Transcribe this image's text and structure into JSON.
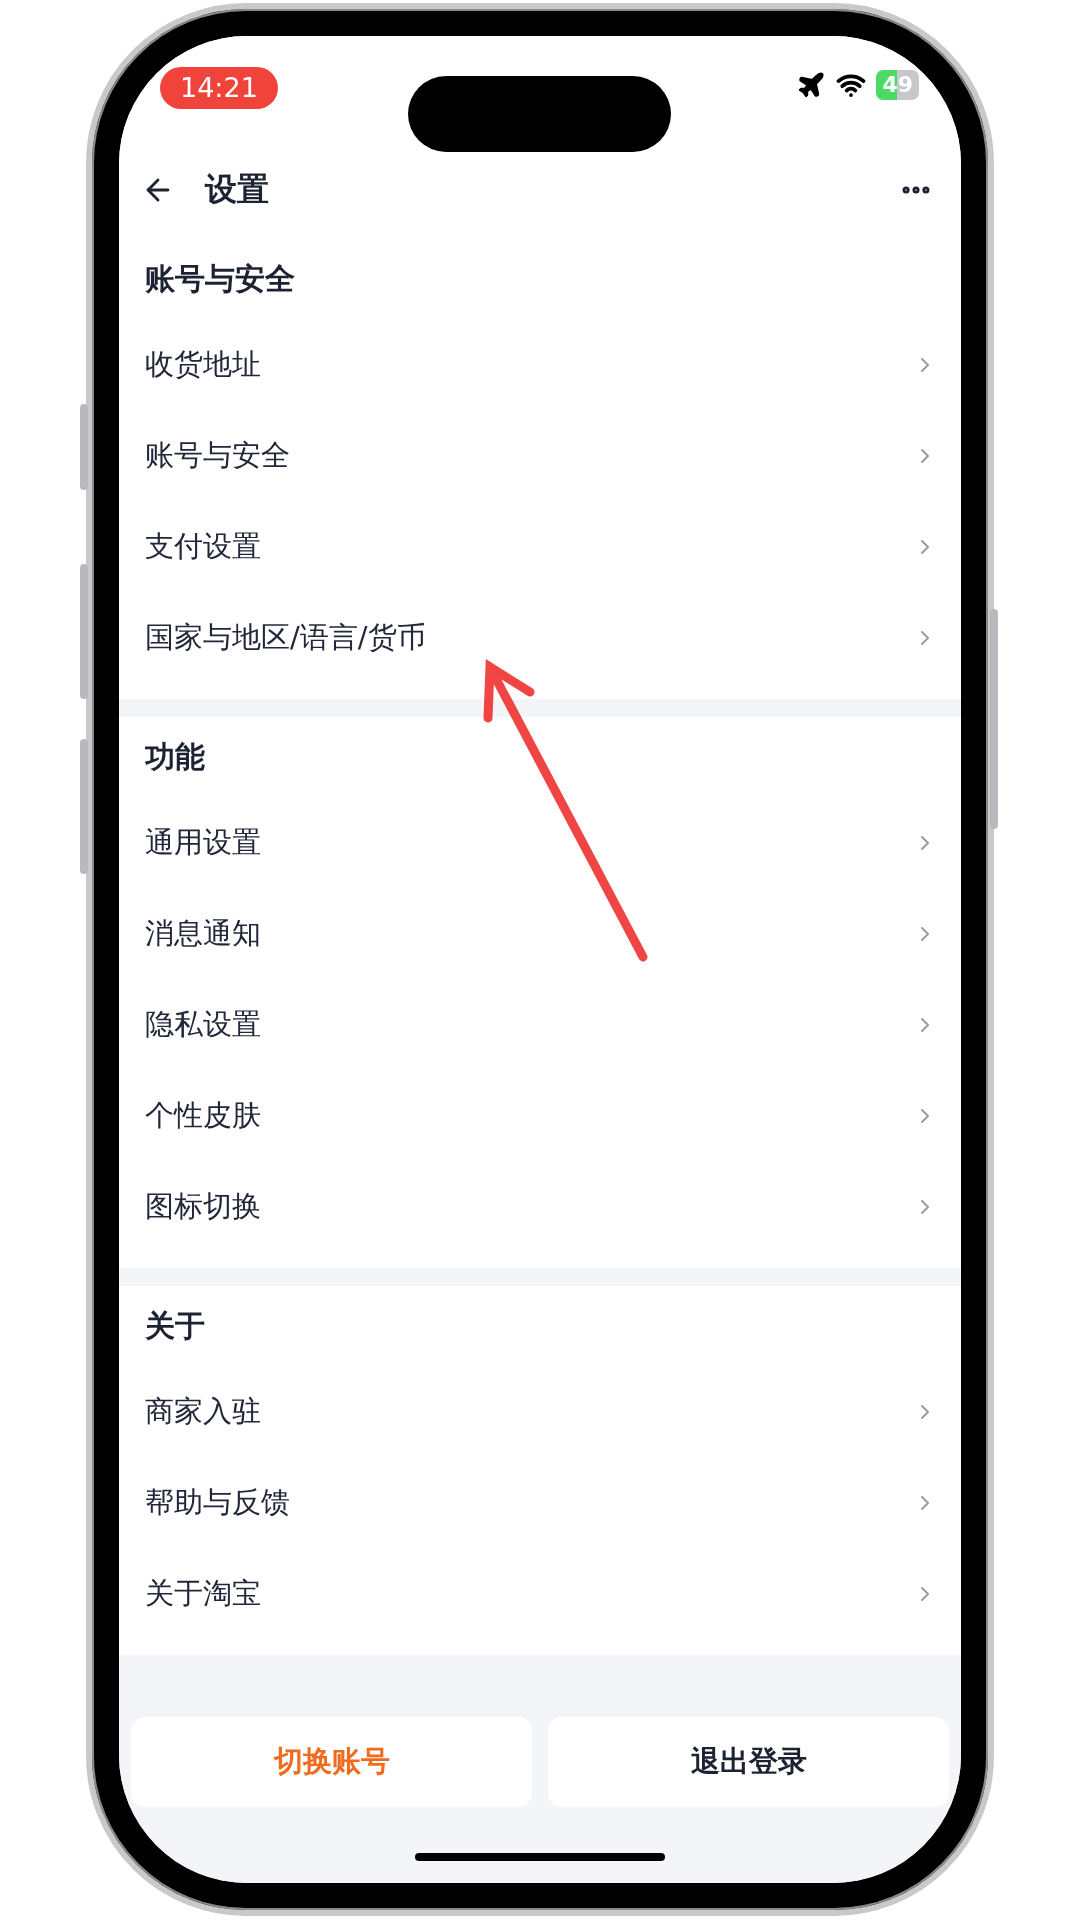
{
  "status_bar": {
    "time": "14:21",
    "battery": "49"
  },
  "header": {
    "title": "设置"
  },
  "sections": [
    {
      "title": "账号与安全",
      "items": [
        {
          "label": "收货地址"
        },
        {
          "label": "账号与安全"
        },
        {
          "label": "支付设置"
        },
        {
          "label": "国家与地区/语言/货币"
        }
      ]
    },
    {
      "title": "功能",
      "items": [
        {
          "label": "通用设置"
        },
        {
          "label": "消息通知"
        },
        {
          "label": "隐私设置"
        },
        {
          "label": "个性皮肤"
        },
        {
          "label": "图标切换"
        }
      ]
    },
    {
      "title": "关于",
      "items": [
        {
          "label": "商家入驻"
        },
        {
          "label": "帮助与反馈"
        },
        {
          "label": "关于淘宝"
        }
      ]
    }
  ],
  "footer": {
    "buttons": [
      {
        "label": "切换账号",
        "kind": "accent"
      },
      {
        "label": "退出登录",
        "kind": "plain"
      }
    ]
  }
}
